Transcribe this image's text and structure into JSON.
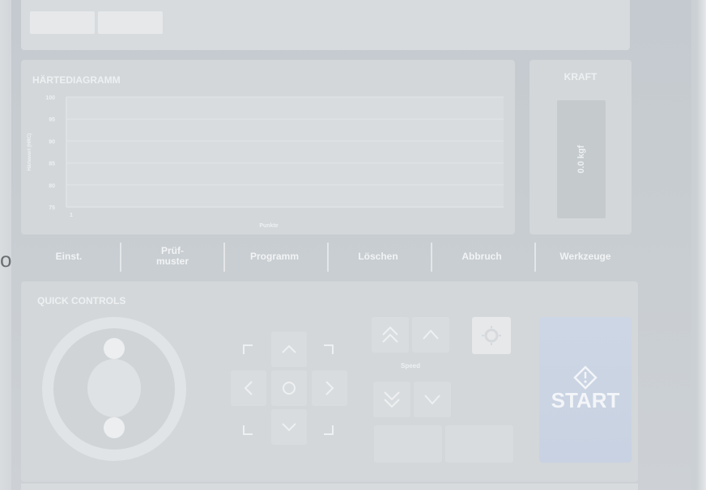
{
  "chart_data": {
    "type": "line",
    "title": "HÄRTEDIAGRAMM",
    "xlabel": "Punkte",
    "ylabel": "Härtewert (HRC)",
    "yticks": [
      "100",
      "95",
      "90",
      "85",
      "80",
      "75"
    ],
    "xticks": [
      "1"
    ],
    "ylim": [
      75,
      100
    ],
    "series": [],
    "grid": true
  },
  "force": {
    "title": "KRAFT",
    "value": "0.0 kgf"
  },
  "menu": {
    "items": [
      "Einst.",
      "Prüf-\nmuster",
      "Programm",
      "Löschen",
      "Abbruch",
      "Werkzeuge"
    ]
  },
  "quick": {
    "title": "QUICK CONTROLS",
    "speed_label": "Speed",
    "start_label": "START"
  },
  "left_edge": {
    "char": "o"
  },
  "colors": {
    "start_accent": "#c8d2e2",
    "panel": "#d3d7da",
    "text": "#eef0f1"
  }
}
